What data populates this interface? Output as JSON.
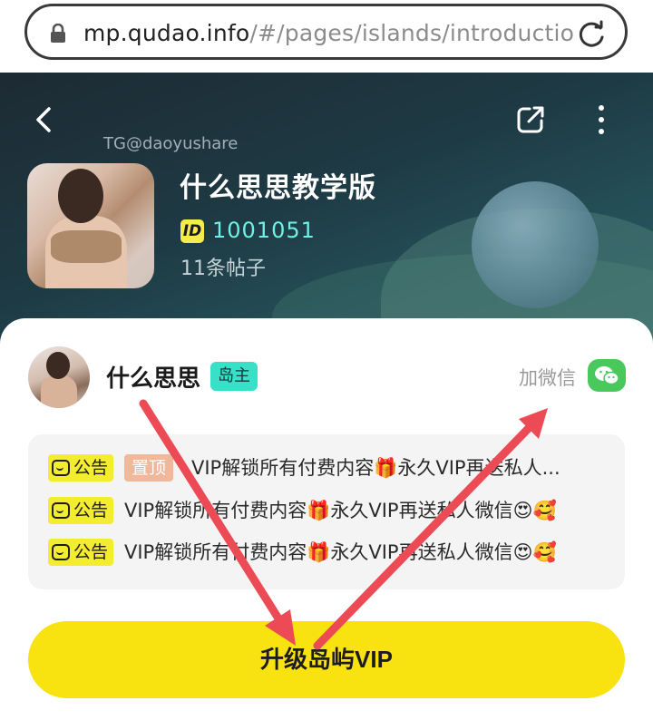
{
  "browser": {
    "url_host": "mp.qudao.info",
    "url_path": "/#/pages/islands/introductio"
  },
  "header": {
    "watermark": "TG@daoyushare",
    "island_name": "什么思思教学版",
    "id_label": "ID",
    "id_value": "1001051",
    "post_count": "11条帖子"
  },
  "owner": {
    "name": "什么思思",
    "badge": "岛主",
    "wechat_label": "加微信"
  },
  "notices": [
    {
      "tag": "公告",
      "pin": "置顶",
      "text": "VIP解锁所有付费内容🎁永久VIP再送私人..."
    },
    {
      "tag": "公告",
      "text": "VIP解锁所有付费内容🎁永久VIP再送私人微信😍🥰"
    },
    {
      "tag": "公告",
      "text": "VIP解锁所有付费内容🎁永久VIP再送私人微信😍🥰"
    }
  ],
  "cta": {
    "label": "升级岛屿VIP"
  },
  "colors": {
    "accent_yellow": "#f8e210",
    "id_teal": "#6ff0e6",
    "owner_badge": "#38e0c8",
    "wechat_green": "#49c85c",
    "arrow_red": "#ec4b55"
  }
}
